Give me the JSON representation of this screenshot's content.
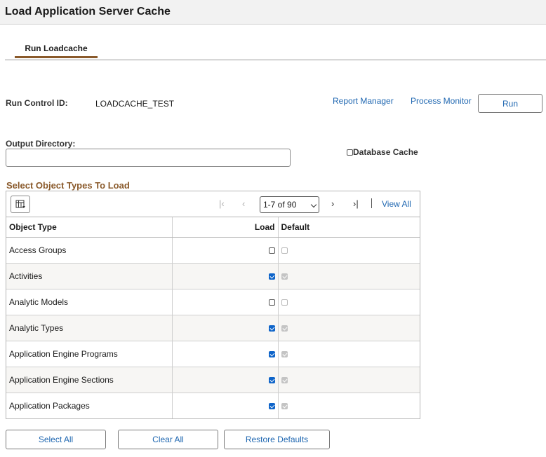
{
  "header": {
    "title": "Load Application Server Cache"
  },
  "tabs": [
    {
      "label": "Run Loadcache",
      "active": true
    }
  ],
  "run_control": {
    "label": "Run Control ID:",
    "value": "LOADCACHE_TEST",
    "report_manager": "Report Manager",
    "process_monitor": "Process Monitor",
    "run_button": "Run"
  },
  "output_directory": {
    "label": "Output Directory:",
    "value": ""
  },
  "database_cache": {
    "label": "Database Cache",
    "checked": false
  },
  "grid": {
    "title": "Select Object Types To Load",
    "pager": "1-7 of 90",
    "view_all": "View All",
    "columns": {
      "type": "Object Type",
      "load": "Load",
      "default": "Default"
    },
    "rows": [
      {
        "type": "Access Groups",
        "load": false,
        "default": false
      },
      {
        "type": "Activities",
        "load": true,
        "default": true
      },
      {
        "type": "Analytic Models",
        "load": false,
        "default": false
      },
      {
        "type": "Analytic Types",
        "load": true,
        "default": true
      },
      {
        "type": "Application Engine Programs",
        "load": true,
        "default": true
      },
      {
        "type": "Application Engine Sections",
        "load": true,
        "default": true
      },
      {
        "type": "Application Packages",
        "load": true,
        "default": true
      }
    ]
  },
  "buttons": {
    "select_all": "Select All",
    "clear_all": "Clear All",
    "restore_defaults": "Restore Defaults"
  },
  "colors": {
    "accent": "#8a5a2b",
    "link": "#1f67b1",
    "checkbox": "#0e64c9"
  }
}
